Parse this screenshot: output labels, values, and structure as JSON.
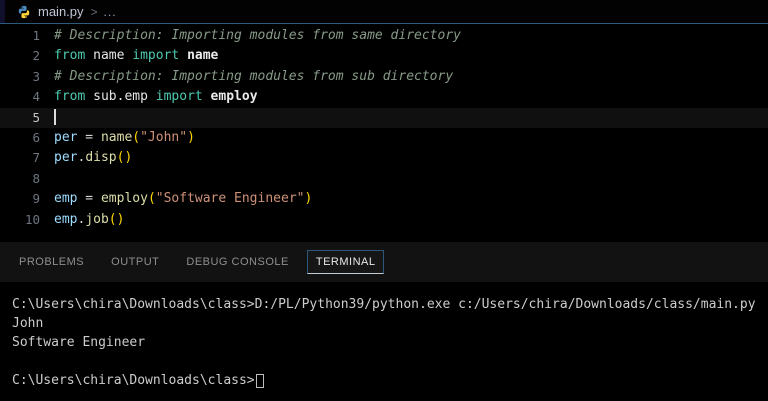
{
  "breadcrumb": {
    "file": "main.py",
    "separator": ">",
    "ellipsis": "..."
  },
  "editor": {
    "lines": [
      {
        "num": "1",
        "comment": "# Description: Importing modules from same directory"
      },
      {
        "num": "2",
        "kw_from": "from",
        "module": " name ",
        "kw_import": "import",
        "imported": " name"
      },
      {
        "num": "3",
        "comment": "# Description: Importing modules from sub directory"
      },
      {
        "num": "4",
        "kw_from": "from",
        "module": " sub.emp ",
        "kw_import": "import",
        "imported": " employ"
      },
      {
        "num": "5"
      },
      {
        "num": "6",
        "variable": "per",
        "op": " = ",
        "func": "name",
        "open": "(",
        "str": "\"John\"",
        "close": ")"
      },
      {
        "num": "7",
        "variable": "per",
        "dot": ".",
        "method": "disp",
        "parens": "()"
      },
      {
        "num": "8"
      },
      {
        "num": "9",
        "variable": "emp",
        "op": " = ",
        "func": "employ",
        "open": "(",
        "str": "\"Software Engineer\"",
        "close": ")"
      },
      {
        "num": "10",
        "variable": "emp",
        "dot": ".",
        "method": "job",
        "parens": "()"
      }
    ]
  },
  "panel": {
    "tabs": [
      {
        "label": "PROBLEMS",
        "active": false
      },
      {
        "label": "OUTPUT",
        "active": false
      },
      {
        "label": "DEBUG CONSOLE",
        "active": false
      },
      {
        "label": "TERMINAL",
        "active": true
      }
    ]
  },
  "terminal": {
    "lines": [
      "C:\\Users\\chira\\Downloads\\class>D:/PL/Python39/python.exe c:/Users/chira/Downloads/class/main.py",
      "John",
      "Software Engineer",
      "",
      "C:\\Users\\chira\\Downloads\\class>"
    ]
  },
  "colors": {
    "separator_blue": "#2b5c7d",
    "keyword": "#4EC9B0",
    "string": "#CE9178",
    "function": "#DCDCAA",
    "variable": "#9CDCFE",
    "comment": "#879A87",
    "bracket": "#FFD700",
    "terminal_text": "#CCCCCC",
    "tab_active_text": "#E8E8E8",
    "python_blue": "#4B8BBE",
    "python_yellow": "#FFD43B"
  }
}
